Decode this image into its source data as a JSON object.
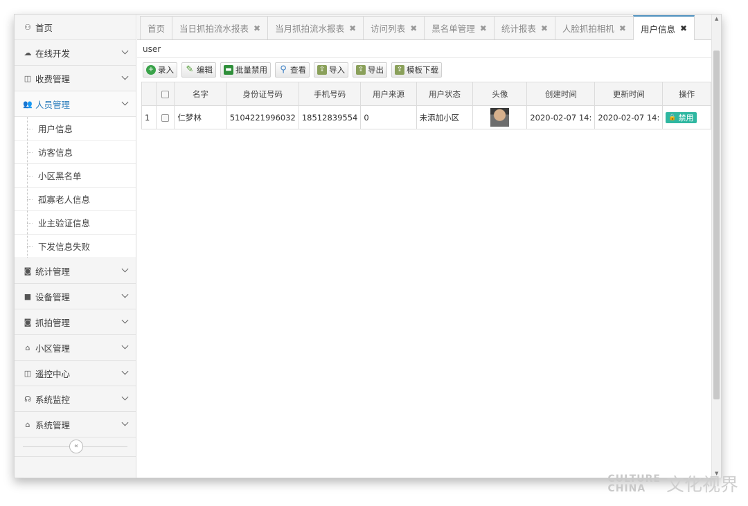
{
  "sidebar": {
    "items": [
      {
        "label": "首页",
        "icon": "dashboard-icon",
        "glyph": "⚇"
      },
      {
        "label": "在线开发",
        "icon": "cloud-icon",
        "glyph": "☁"
      },
      {
        "label": "收费管理",
        "icon": "columns-icon",
        "glyph": "◫"
      },
      {
        "label": "人员管理",
        "icon": "users-icon",
        "glyph": "👥"
      },
      {
        "label": "统计管理",
        "icon": "camera-icon",
        "glyph": "◙"
      },
      {
        "label": "设备管理",
        "icon": "video-camera-icon",
        "glyph": "■"
      },
      {
        "label": "抓拍管理",
        "icon": "camera-icon",
        "glyph": "◙"
      },
      {
        "label": "小区管理",
        "icon": "home-icon",
        "glyph": "⌂"
      },
      {
        "label": "遥控中心",
        "icon": "columns-icon",
        "glyph": "◫"
      },
      {
        "label": "系统监控",
        "icon": "headphones-icon",
        "glyph": "☊"
      },
      {
        "label": "系统管理",
        "icon": "home-icon",
        "glyph": "⌂"
      }
    ],
    "submenu": [
      "用户信息",
      "访客信息",
      "小区黑名单",
      "孤寡老人信息",
      "业主验证信息",
      "下发信息失败"
    ],
    "collapse_glyph": "«"
  },
  "tabs": [
    {
      "label": "首页",
      "closable": false
    },
    {
      "label": "当日抓拍流水报表",
      "closable": true
    },
    {
      "label": "当月抓拍流水报表",
      "closable": true
    },
    {
      "label": "访问列表",
      "closable": true
    },
    {
      "label": "黑名单管理",
      "closable": true
    },
    {
      "label": "统计报表",
      "closable": true
    },
    {
      "label": "人脸抓拍相机",
      "closable": true
    },
    {
      "label": "用户信息",
      "closable": true,
      "active": true
    }
  ],
  "tab_close_glyph": "✖",
  "panel_title": "user",
  "toolbar": [
    {
      "label": "录入",
      "icon": "add-icon",
      "glyph": "+",
      "color": "#3aa34a"
    },
    {
      "label": "编辑",
      "icon": "pencil-icon",
      "glyph": "✎",
      "color": "#4e9a32"
    },
    {
      "label": "批量禁用",
      "icon": "ban-icon",
      "glyph": "▬",
      "color": "#2f8f3a"
    },
    {
      "label": "查看",
      "icon": "magnifier-icon",
      "glyph": "⚲",
      "color": "#3b7fc4"
    },
    {
      "label": "导入",
      "icon": "import-icon",
      "glyph": "⇪",
      "color": "#8aa05a"
    },
    {
      "label": "导出",
      "icon": "export-icon",
      "glyph": "⇪",
      "color": "#8aa05a"
    },
    {
      "label": "模板下载",
      "icon": "download-icon",
      "glyph": "⇪",
      "color": "#8aa05a"
    }
  ],
  "table": {
    "columns": [
      "名字",
      "身份证号码",
      "手机号码",
      "用户来源",
      "用户状态",
      "头像",
      "创建时间",
      "更新时间",
      "操作"
    ],
    "rows": [
      {
        "index": "1",
        "name": "仁梦林",
        "id_number": "5104221996032",
        "phone": "18512839554",
        "source": "0",
        "status": "未添加小区",
        "created": "2020-02-07 14:",
        "updated": "2020-02-07 14:",
        "action": "禁用"
      }
    ]
  },
  "watermark": {
    "en_top": "CULTURE",
    "en_bottom": "CHINA",
    "zh": "文化视界"
  },
  "colors": {
    "accent": "#2b7dbc",
    "action_button": "#2fb7a1",
    "active_tab_border": "#4c8fbd"
  }
}
